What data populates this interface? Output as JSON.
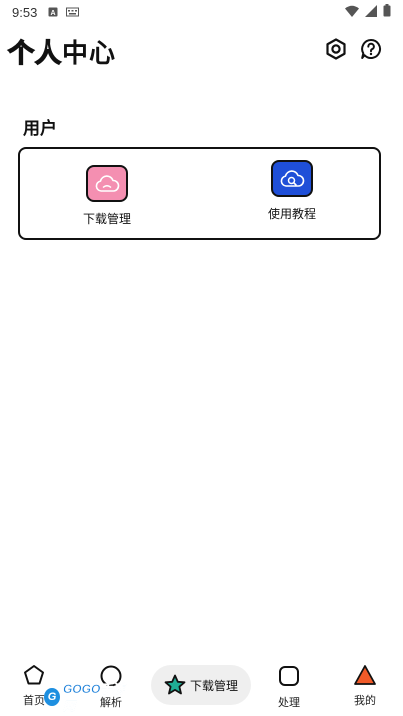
{
  "status_bar": {
    "time": "9:53",
    "left_icons": [
      "a-notification-icon",
      "keyboard-icon"
    ],
    "right_icons": [
      "wifi-icon",
      "signal-icon",
      "battery-icon"
    ]
  },
  "header": {
    "title_outline": "个人",
    "title_solid": "中心",
    "settings_icon": "settings-icon",
    "help_icon": "help-icon"
  },
  "section": {
    "label": "用户"
  },
  "card_items": [
    {
      "label": "下载管理",
      "icon": "cloud-icon",
      "bg": "#f48fb1"
    },
    {
      "label": "使用教程",
      "icon": "cloud-search-icon",
      "bg": "#1f4fd8"
    }
  ],
  "bottom_nav": {
    "items": [
      {
        "label": "首页",
        "icon": "pentagon-icon"
      },
      {
        "label": "解析",
        "icon": "circle-icon"
      },
      {
        "label": "下载管理",
        "icon": "star-icon",
        "active": true,
        "accent": "#1fae95"
      },
      {
        "label": "处理",
        "icon": "rounded-square-icon"
      },
      {
        "label": "我的",
        "icon": "triangle-icon",
        "accent": "#f05a28"
      }
    ]
  },
  "watermark": {
    "text": "GOGO手游网"
  }
}
